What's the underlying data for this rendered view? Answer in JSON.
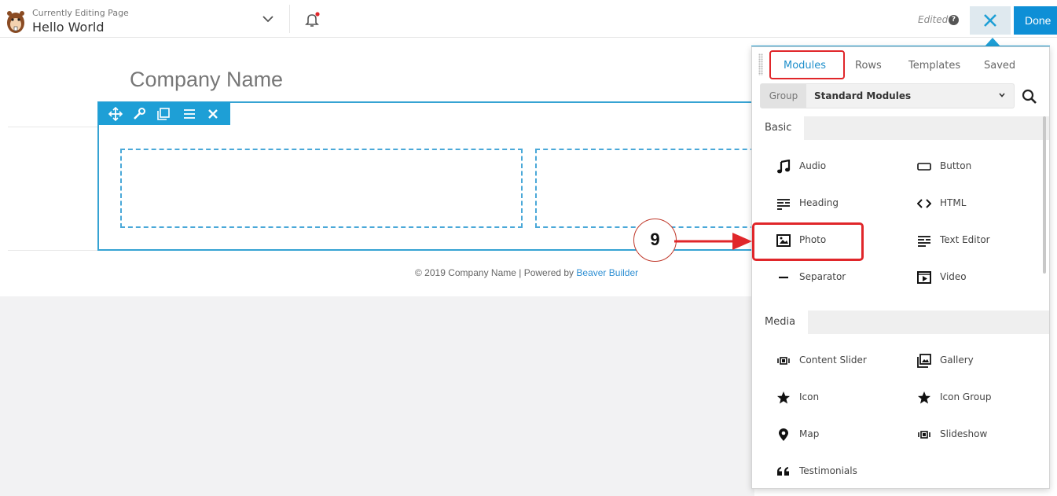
{
  "topbar": {
    "label": "Currently Editing Page",
    "page_title": "Hello World",
    "status": "Edited",
    "help_icon": "?",
    "done_label": "Done"
  },
  "page": {
    "company_name": "Company Name",
    "footer_text": "© 2019 Company Name | Powered by ",
    "footer_link": "Beaver Builder"
  },
  "panel": {
    "tabs": [
      "Modules",
      "Rows",
      "Templates",
      "Saved"
    ],
    "active_tab": "Modules",
    "group_label": "Group",
    "group_value": "Standard Modules",
    "sections": [
      {
        "title": "Basic",
        "modules": [
          {
            "label": "Audio",
            "icon": "music-note-icon"
          },
          {
            "label": "Button",
            "icon": "button-icon"
          },
          {
            "label": "Heading",
            "icon": "heading-icon"
          },
          {
            "label": "HTML",
            "icon": "code-icon"
          },
          {
            "label": "Photo",
            "icon": "photo-icon"
          },
          {
            "label": "Text Editor",
            "icon": "text-editor-icon"
          },
          {
            "label": "Separator",
            "icon": "separator-icon"
          },
          {
            "label": "Video",
            "icon": "video-icon"
          }
        ]
      },
      {
        "title": "Media",
        "modules": [
          {
            "label": "Content Slider",
            "icon": "slider-icon"
          },
          {
            "label": "Gallery",
            "icon": "gallery-icon"
          },
          {
            "label": "Icon",
            "icon": "star-icon"
          },
          {
            "label": "Icon Group",
            "icon": "star-icon"
          },
          {
            "label": "Map",
            "icon": "map-pin-icon"
          },
          {
            "label": "Slideshow",
            "icon": "slideshow-icon"
          },
          {
            "label": "Testimonials",
            "icon": "quote-icon"
          }
        ]
      }
    ]
  },
  "annotation": {
    "step_number": "9",
    "highlight_color": "#e0262a"
  },
  "colors": {
    "accent": "#1e9fd6",
    "done_button": "#0e8fd6",
    "row_outline": "#36a3d3"
  }
}
